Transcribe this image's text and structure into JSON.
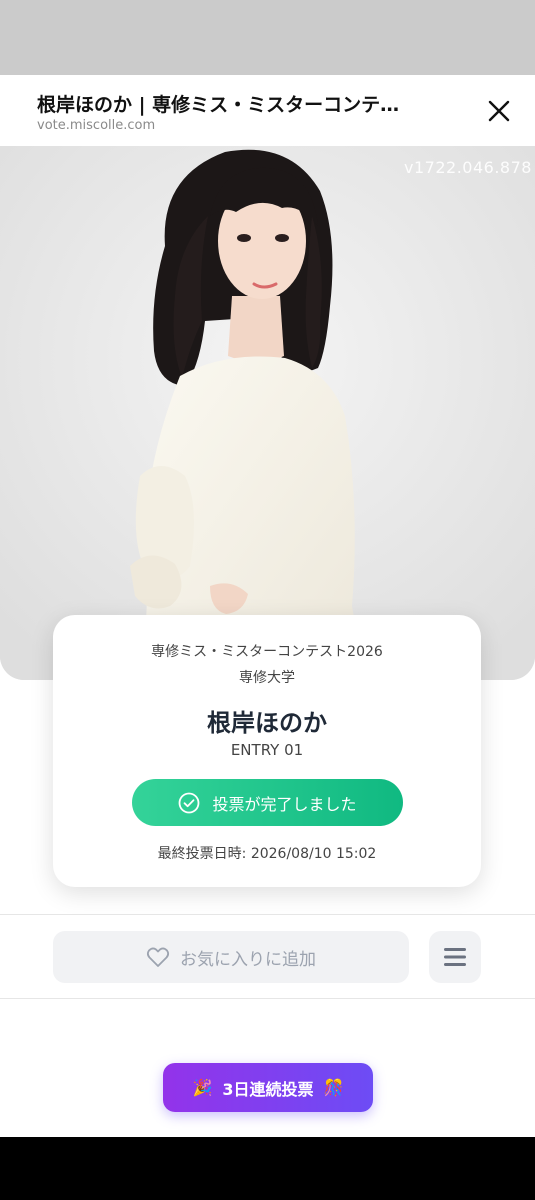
{
  "header": {
    "title": "根岸ほのか | 専修ミス・ミスターコンテスト2026",
    "url": "vote.miscolle.com"
  },
  "photo": {
    "watermark": "v1722.046.878"
  },
  "card": {
    "contest": "専修ミス・ミスターコンテスト2026",
    "school": "専修大学",
    "name": "根岸ほのか",
    "entry": "ENTRY 01",
    "vote_button_label": "投票が完了しました",
    "vote_time": "最終投票日時: 2026/08/10 15:02"
  },
  "actions": {
    "favorite_label": "お気に入りに追加",
    "streak_label": "3日連続投票",
    "streak_emoji_left": "🎉",
    "streak_emoji_right": "🎊"
  },
  "icons": {
    "close": "close-icon",
    "check": "check-circle-icon",
    "heart": "heart-outline-icon",
    "menu": "menu-icon"
  },
  "colors": {
    "vote_green": "#10b981",
    "streak_purple": "#7c3aed",
    "sheet_backdrop": "#cbcbcb"
  }
}
